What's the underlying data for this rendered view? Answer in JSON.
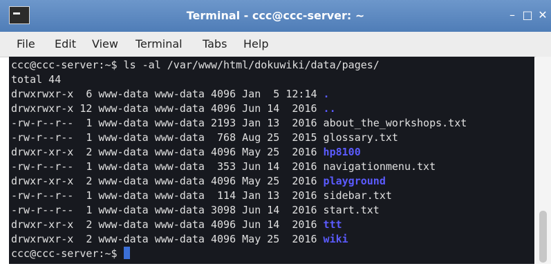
{
  "window": {
    "title": "Terminal - ccc@ccc-server: ~",
    "minimize_glyph": "–",
    "maximize_glyph": "□",
    "close_glyph": "✕"
  },
  "menu": {
    "items": [
      "File",
      "Edit",
      "View",
      "Terminal",
      "Tabs",
      "Help"
    ]
  },
  "terminal": {
    "command_line": "ccc@ccc-server:~$ ls -al /var/www/html/dokuwiki/data/pages/",
    "total_line": "total 44",
    "entries": [
      {
        "prefix": "drwxrwxr-x  6 www-data www-data 4096 Jan  5 12:14 ",
        "name": "."
      },
      {
        "prefix": "drwxrwxr-x 12 www-data www-data 4096 Jun 14  2016 ",
        "name": ".."
      },
      {
        "prefix": "-rw-r--r--  1 www-data www-data 2193 Jan 13  2016 ",
        "name": "about_the_workshops.txt"
      },
      {
        "prefix": "-rw-r--r--  1 www-data www-data  768 Aug 25  2015 ",
        "name": "glossary.txt"
      },
      {
        "prefix": "drwxr-xr-x  2 www-data www-data 4096 May 25  2016 ",
        "name": "hp8100"
      },
      {
        "prefix": "-rw-r--r--  1 www-data www-data  353 Jun 14  2016 ",
        "name": "navigationmenu.txt"
      },
      {
        "prefix": "drwxr-xr-x  2 www-data www-data 4096 May 25  2016 ",
        "name": "playground"
      },
      {
        "prefix": "-rw-r--r--  1 www-data www-data  114 Jan 13  2016 ",
        "name": "sidebar.txt"
      },
      {
        "prefix": "-rw-r--r--  1 www-data www-data 3098 Jun 14  2016 ",
        "name": "start.txt"
      },
      {
        "prefix": "drwxr-xr-x  2 www-data www-data 4096 Jun 14  2016 ",
        "name": "ttt"
      },
      {
        "prefix": "drwxrwxr-x  2 www-data www-data 4096 May 25  2016 ",
        "name": "wiki"
      }
    ],
    "prompt": "ccc@ccc-server:~$ "
  }
}
